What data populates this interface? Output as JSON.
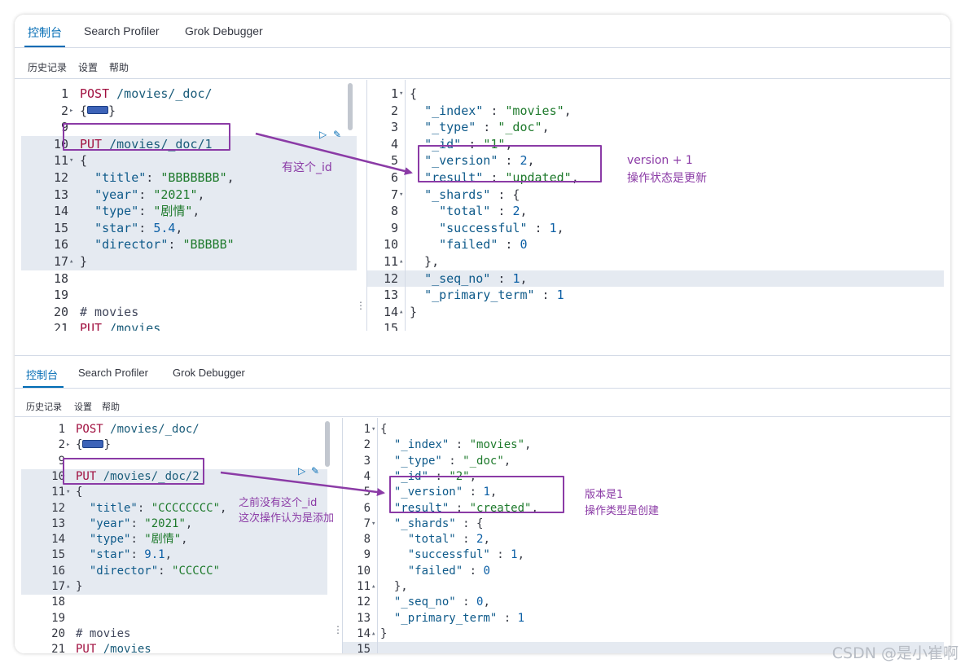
{
  "top": {
    "tabs": [
      {
        "label": "控制台",
        "active": true
      },
      {
        "label": "Search Profiler",
        "active": false
      },
      {
        "label": "Grok Debugger",
        "active": false
      }
    ],
    "menu": [
      "历史记录",
      "设置",
      "帮助"
    ],
    "request_lines": [
      {
        "n": "1",
        "fold": "",
        "tokens": [
          [
            "k",
            "POST"
          ],
          [
            "plain",
            " "
          ],
          [
            "url",
            "/movies/_doc/"
          ]
        ]
      },
      {
        "n": "2",
        "fold": "▸",
        "tokens": [
          [
            "plain",
            "{"
          ],
          [
            "pill",
            ""
          ],
          [
            "plain",
            "}"
          ]
        ]
      },
      {
        "n": "9",
        "fold": "",
        "tokens": []
      },
      {
        "n": "10",
        "fold": "",
        "tokens": [
          [
            "k",
            "PUT"
          ],
          [
            "plain",
            " "
          ],
          [
            "url",
            "/movies/_doc/1"
          ]
        ]
      },
      {
        "n": "11",
        "fold": "▾",
        "tokens": [
          [
            "plain",
            "{"
          ]
        ]
      },
      {
        "n": "12",
        "fold": "",
        "tokens": [
          [
            "plain",
            "  "
          ],
          [
            "key",
            "\"title\""
          ],
          [
            "plain",
            ": "
          ],
          [
            "str",
            "\"BBBBBBB\""
          ],
          [
            "plain",
            ","
          ]
        ]
      },
      {
        "n": "13",
        "fold": "",
        "tokens": [
          [
            "plain",
            "  "
          ],
          [
            "key",
            "\"year\""
          ],
          [
            "plain",
            ": "
          ],
          [
            "str",
            "\"2021\""
          ],
          [
            "plain",
            ","
          ]
        ]
      },
      {
        "n": "14",
        "fold": "",
        "tokens": [
          [
            "plain",
            "  "
          ],
          [
            "key",
            "\"type\""
          ],
          [
            "plain",
            ": "
          ],
          [
            "str",
            "\"剧情\""
          ],
          [
            "plain",
            ","
          ]
        ]
      },
      {
        "n": "15",
        "fold": "",
        "tokens": [
          [
            "plain",
            "  "
          ],
          [
            "key",
            "\"star\""
          ],
          [
            "plain",
            ": "
          ],
          [
            "num",
            "5.4"
          ],
          [
            "plain",
            ","
          ]
        ]
      },
      {
        "n": "16",
        "fold": "",
        "tokens": [
          [
            "plain",
            "  "
          ],
          [
            "key",
            "\"director\""
          ],
          [
            "plain",
            ": "
          ],
          [
            "str",
            "\"BBBBB\""
          ]
        ]
      },
      {
        "n": "17",
        "fold": "▴",
        "tokens": [
          [
            "plain",
            "}"
          ]
        ]
      },
      {
        "n": "18",
        "fold": "",
        "tokens": []
      },
      {
        "n": "19",
        "fold": "",
        "tokens": []
      },
      {
        "n": "20",
        "fold": "",
        "tokens": [
          [
            "cmt",
            "# movies"
          ]
        ]
      },
      {
        "n": "21",
        "fold": "",
        "tokens": [
          [
            "k",
            "PUT"
          ],
          [
            "plain",
            " "
          ],
          [
            "url",
            "/movies"
          ]
        ]
      }
    ],
    "response_lines": [
      {
        "n": "1",
        "fold": "▾",
        "tokens": [
          [
            "plain",
            "{"
          ]
        ]
      },
      {
        "n": "2",
        "fold": "",
        "tokens": [
          [
            "plain",
            "  "
          ],
          [
            "key",
            "\"_index\""
          ],
          [
            "plain",
            " : "
          ],
          [
            "str",
            "\"movies\""
          ],
          [
            "plain",
            ","
          ]
        ]
      },
      {
        "n": "3",
        "fold": "",
        "tokens": [
          [
            "plain",
            "  "
          ],
          [
            "key",
            "\"_type\""
          ],
          [
            "plain",
            " : "
          ],
          [
            "str",
            "\"_doc\""
          ],
          [
            "plain",
            ","
          ]
        ]
      },
      {
        "n": "4",
        "fold": "",
        "tokens": [
          [
            "plain",
            "  "
          ],
          [
            "key",
            "\"_id\""
          ],
          [
            "plain",
            " : "
          ],
          [
            "str",
            "\"1\""
          ],
          [
            "plain",
            ","
          ]
        ]
      },
      {
        "n": "5",
        "fold": "",
        "tokens": [
          [
            "plain",
            "  "
          ],
          [
            "key",
            "\"_version\""
          ],
          [
            "plain",
            " : "
          ],
          [
            "num",
            "2"
          ],
          [
            "plain",
            ","
          ]
        ]
      },
      {
        "n": "6",
        "fold": "",
        "tokens": [
          [
            "plain",
            "  "
          ],
          [
            "key",
            "\"result\""
          ],
          [
            "plain",
            " : "
          ],
          [
            "str",
            "\"updated\""
          ],
          [
            "plain",
            ","
          ]
        ]
      },
      {
        "n": "7",
        "fold": "▾",
        "tokens": [
          [
            "plain",
            "  "
          ],
          [
            "key",
            "\"_shards\""
          ],
          [
            "plain",
            " : {"
          ]
        ]
      },
      {
        "n": "8",
        "fold": "",
        "tokens": [
          [
            "plain",
            "    "
          ],
          [
            "key",
            "\"total\""
          ],
          [
            "plain",
            " : "
          ],
          [
            "num",
            "2"
          ],
          [
            "plain",
            ","
          ]
        ]
      },
      {
        "n": "9",
        "fold": "",
        "tokens": [
          [
            "plain",
            "    "
          ],
          [
            "key",
            "\"successful\""
          ],
          [
            "plain",
            " : "
          ],
          [
            "num",
            "1"
          ],
          [
            "plain",
            ","
          ]
        ]
      },
      {
        "n": "10",
        "fold": "",
        "tokens": [
          [
            "plain",
            "    "
          ],
          [
            "key",
            "\"failed\""
          ],
          [
            "plain",
            " : "
          ],
          [
            "num",
            "0"
          ]
        ]
      },
      {
        "n": "11",
        "fold": "▴",
        "tokens": [
          [
            "plain",
            "  },"
          ]
        ]
      },
      {
        "n": "12",
        "fold": "",
        "tokens": [
          [
            "plain",
            "  "
          ],
          [
            "key",
            "\"_seq_no\""
          ],
          [
            "plain",
            " : "
          ],
          [
            "num",
            "1"
          ],
          [
            "plain",
            ","
          ]
        ]
      },
      {
        "n": "13",
        "fold": "",
        "tokens": [
          [
            "plain",
            "  "
          ],
          [
            "key",
            "\"_primary_term\""
          ],
          [
            "plain",
            " : "
          ],
          [
            "num",
            "1"
          ]
        ]
      },
      {
        "n": "14",
        "fold": "▴",
        "tokens": [
          [
            "plain",
            "}"
          ]
        ]
      },
      {
        "n": "15",
        "fold": "",
        "tokens": []
      }
    ],
    "annotations": {
      "request_note": "有这个_id",
      "response_note_1": "version + 1",
      "response_note_2": "操作状态是更新"
    }
  },
  "bottom": {
    "tabs": [
      {
        "label": "控制台",
        "active": true
      },
      {
        "label": "Search Profiler",
        "active": false
      },
      {
        "label": "Grok Debugger",
        "active": false
      }
    ],
    "menu": [
      "历史记录",
      "设置",
      "帮助"
    ],
    "request_lines": [
      {
        "n": "1",
        "fold": "",
        "tokens": [
          [
            "k",
            "POST"
          ],
          [
            "plain",
            " "
          ],
          [
            "url",
            "/movies/_doc/"
          ]
        ]
      },
      {
        "n": "2",
        "fold": "▸",
        "tokens": [
          [
            "plain",
            "{"
          ],
          [
            "pill",
            ""
          ],
          [
            "plain",
            "}"
          ]
        ]
      },
      {
        "n": "9",
        "fold": "",
        "tokens": []
      },
      {
        "n": "10",
        "fold": "",
        "tokens": [
          [
            "k",
            "PUT"
          ],
          [
            "plain",
            " "
          ],
          [
            "url",
            "/movies/_doc/2"
          ]
        ]
      },
      {
        "n": "11",
        "fold": "▾",
        "tokens": [
          [
            "plain",
            "{"
          ]
        ]
      },
      {
        "n": "12",
        "fold": "",
        "tokens": [
          [
            "plain",
            "  "
          ],
          [
            "key",
            "\"title\""
          ],
          [
            "plain",
            ": "
          ],
          [
            "str",
            "\"CCCCCCCC\""
          ],
          [
            "plain",
            ","
          ]
        ]
      },
      {
        "n": "13",
        "fold": "",
        "tokens": [
          [
            "plain",
            "  "
          ],
          [
            "key",
            "\"year\""
          ],
          [
            "plain",
            ": "
          ],
          [
            "str",
            "\"2021\""
          ],
          [
            "plain",
            ","
          ]
        ]
      },
      {
        "n": "14",
        "fold": "",
        "tokens": [
          [
            "plain",
            "  "
          ],
          [
            "key",
            "\"type\""
          ],
          [
            "plain",
            ": "
          ],
          [
            "str",
            "\"剧情\""
          ],
          [
            "plain",
            ","
          ]
        ]
      },
      {
        "n": "15",
        "fold": "",
        "tokens": [
          [
            "plain",
            "  "
          ],
          [
            "key",
            "\"star\""
          ],
          [
            "plain",
            ": "
          ],
          [
            "num",
            "9.1"
          ],
          [
            "plain",
            ","
          ]
        ]
      },
      {
        "n": "16",
        "fold": "",
        "tokens": [
          [
            "plain",
            "  "
          ],
          [
            "key",
            "\"director\""
          ],
          [
            "plain",
            ": "
          ],
          [
            "str",
            "\"CCCCC\""
          ]
        ]
      },
      {
        "n": "17",
        "fold": "▴",
        "tokens": [
          [
            "plain",
            "}"
          ]
        ]
      },
      {
        "n": "18",
        "fold": "",
        "tokens": []
      },
      {
        "n": "19",
        "fold": "",
        "tokens": []
      },
      {
        "n": "20",
        "fold": "",
        "tokens": [
          [
            "cmt",
            "# movies"
          ]
        ]
      },
      {
        "n": "21",
        "fold": "",
        "tokens": [
          [
            "k",
            "PUT"
          ],
          [
            "plain",
            " "
          ],
          [
            "url",
            "/movies"
          ]
        ]
      }
    ],
    "response_lines": [
      {
        "n": "1",
        "fold": "▾",
        "tokens": [
          [
            "plain",
            "{"
          ]
        ]
      },
      {
        "n": "2",
        "fold": "",
        "tokens": [
          [
            "plain",
            "  "
          ],
          [
            "key",
            "\"_index\""
          ],
          [
            "plain",
            " : "
          ],
          [
            "str",
            "\"movies\""
          ],
          [
            "plain",
            ","
          ]
        ]
      },
      {
        "n": "3",
        "fold": "",
        "tokens": [
          [
            "plain",
            "  "
          ],
          [
            "key",
            "\"_type\""
          ],
          [
            "plain",
            " : "
          ],
          [
            "str",
            "\"_doc\""
          ],
          [
            "plain",
            ","
          ]
        ]
      },
      {
        "n": "4",
        "fold": "",
        "tokens": [
          [
            "plain",
            "  "
          ],
          [
            "key",
            "\"_id\""
          ],
          [
            "plain",
            " : "
          ],
          [
            "str",
            "\"2\""
          ],
          [
            "plain",
            ","
          ]
        ]
      },
      {
        "n": "5",
        "fold": "",
        "tokens": [
          [
            "plain",
            "  "
          ],
          [
            "key",
            "\"_version\""
          ],
          [
            "plain",
            " : "
          ],
          [
            "num",
            "1"
          ],
          [
            "plain",
            ","
          ]
        ]
      },
      {
        "n": "6",
        "fold": "",
        "tokens": [
          [
            "plain",
            "  "
          ],
          [
            "key",
            "\"result\""
          ],
          [
            "plain",
            " : "
          ],
          [
            "str",
            "\"created\""
          ],
          [
            "plain",
            ","
          ]
        ]
      },
      {
        "n": "7",
        "fold": "▾",
        "tokens": [
          [
            "plain",
            "  "
          ],
          [
            "key",
            "\"_shards\""
          ],
          [
            "plain",
            " : {"
          ]
        ]
      },
      {
        "n": "8",
        "fold": "",
        "tokens": [
          [
            "plain",
            "    "
          ],
          [
            "key",
            "\"total\""
          ],
          [
            "plain",
            " : "
          ],
          [
            "num",
            "2"
          ],
          [
            "plain",
            ","
          ]
        ]
      },
      {
        "n": "9",
        "fold": "",
        "tokens": [
          [
            "plain",
            "    "
          ],
          [
            "key",
            "\"successful\""
          ],
          [
            "plain",
            " : "
          ],
          [
            "num",
            "1"
          ],
          [
            "plain",
            ","
          ]
        ]
      },
      {
        "n": "10",
        "fold": "",
        "tokens": [
          [
            "plain",
            "    "
          ],
          [
            "key",
            "\"failed\""
          ],
          [
            "plain",
            " : "
          ],
          [
            "num",
            "0"
          ]
        ]
      },
      {
        "n": "11",
        "fold": "▴",
        "tokens": [
          [
            "plain",
            "  },"
          ]
        ]
      },
      {
        "n": "12",
        "fold": "",
        "tokens": [
          [
            "plain",
            "  "
          ],
          [
            "key",
            "\"_seq_no\""
          ],
          [
            "plain",
            " : "
          ],
          [
            "num",
            "0"
          ],
          [
            "plain",
            ","
          ]
        ]
      },
      {
        "n": "13",
        "fold": "",
        "tokens": [
          [
            "plain",
            "  "
          ],
          [
            "key",
            "\"_primary_term\""
          ],
          [
            "plain",
            " : "
          ],
          [
            "num",
            "1"
          ]
        ]
      },
      {
        "n": "14",
        "fold": "▴",
        "tokens": [
          [
            "plain",
            "}"
          ]
        ]
      },
      {
        "n": "15",
        "fold": "",
        "tokens": []
      }
    ],
    "annotations": {
      "request_note_1": "之前没有这个_id",
      "request_note_2": "这次操作认为是添加",
      "response_note_1": "版本是1",
      "response_note_2": "操作类型是创建"
    }
  },
  "icons": {
    "run": "play-icon",
    "settings": "wrench-icon",
    "resize": "vertical-dots-icon"
  },
  "colors": {
    "accent": "#006bb4",
    "annotation": "#8b3ba6",
    "highlight": "#e5eaf1"
  },
  "watermark": "CSDN @是小崔啊"
}
